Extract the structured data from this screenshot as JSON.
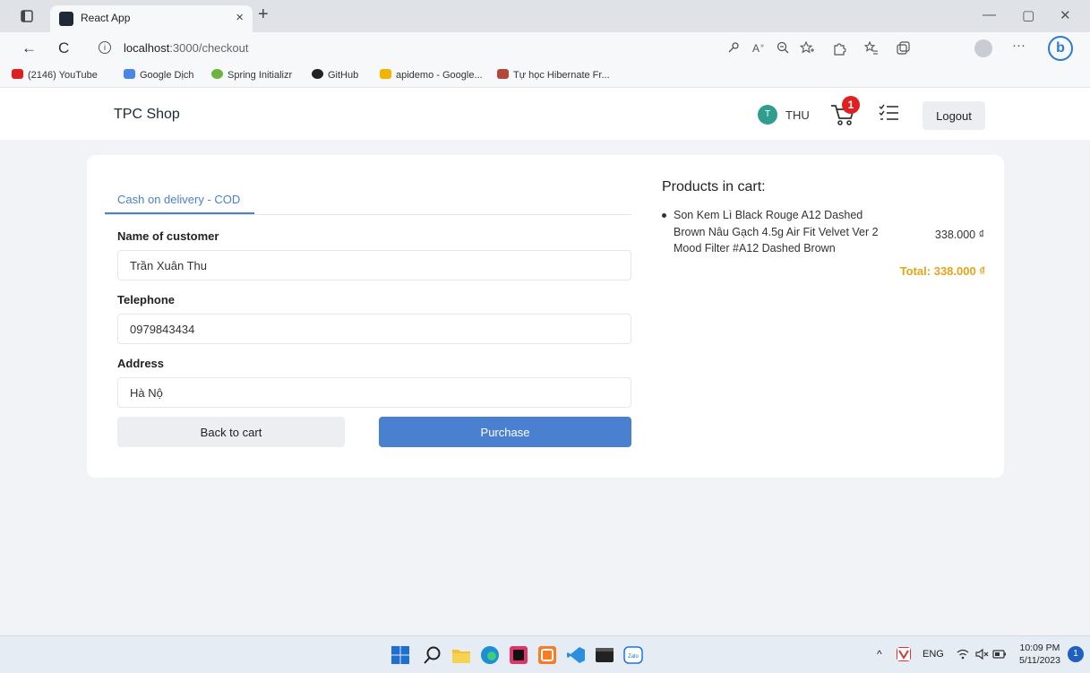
{
  "browser": {
    "tab_title": "React App",
    "tab_close": "×",
    "new_tab": "+",
    "url_host": "localhost",
    "url_path": ":3000/checkout",
    "window_controls": {
      "minimize": "—",
      "restore": "▢",
      "close": "✕"
    },
    "nav": {
      "back": "←",
      "reload": "C",
      "info": "i"
    },
    "more": "···",
    "bing": "b"
  },
  "bookmarks": [
    {
      "label": "(2146) YouTube",
      "color": "#e02020"
    },
    {
      "label": "Google Dịch",
      "color": "#4a86e8"
    },
    {
      "label": "Spring Initializr",
      "color": "#6db33f"
    },
    {
      "label": "GitHub",
      "color": "#222222"
    },
    {
      "label": "apidemo - Google...",
      "color": "#f2b400"
    },
    {
      "label": "Tự học Hibernate Fr...",
      "color": "#b2473a"
    }
  ],
  "header": {
    "brand": "TPC Shop",
    "avatar_initial": "T",
    "user_name": "THU",
    "cart_count": "1",
    "logout": "Logout"
  },
  "checkout": {
    "tab_label": "Cash on delivery - COD",
    "fields": {
      "name_label": "Name of customer",
      "name_value": "Trần Xuân Thu",
      "phone_label": "Telephone",
      "phone_value": "0979843434",
      "address_label": "Address",
      "address_value": "Hà Nộ"
    },
    "back_button": "Back to cart",
    "purchase_button": "Purchase"
  },
  "cart": {
    "title": "Products in cart:",
    "items": [
      {
        "name": "Son Kem Lì Black Rouge A12 Dashed Brown Nâu Gạch 4.5g Air Fit Velvet Ver 2 Mood Filter #A12 Dashed Brown",
        "price": "338.000 ₫"
      }
    ],
    "total": "Total: 338.000 ₫"
  },
  "taskbar": {
    "tray_lang": "ENG",
    "time": "10:09 PM",
    "date": "5/11/2023",
    "notifications": "1",
    "zalo": "Zalo"
  },
  "colors": {
    "accent": "#4a80d0",
    "total": "#e8a317",
    "badge": "#e02020",
    "avatar": "#2f9e8f"
  }
}
